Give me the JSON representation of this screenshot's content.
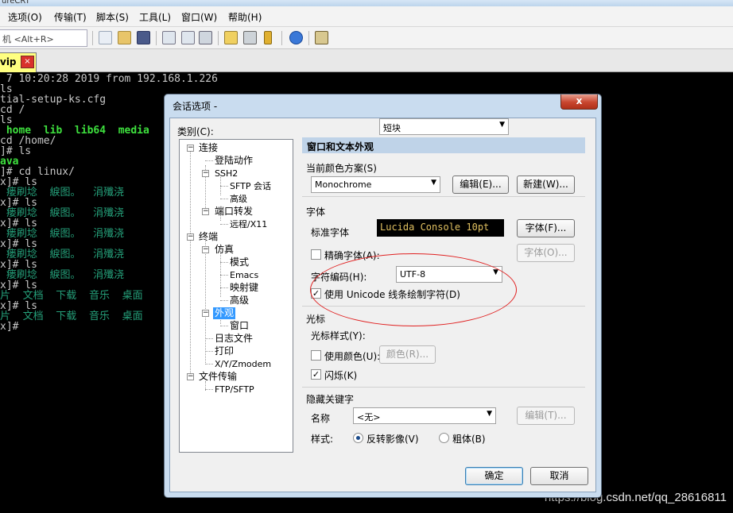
{
  "app": {
    "menu": [
      "选项(O)",
      "传输(T)",
      "脚本(S)",
      "工具(L)",
      "窗口(W)",
      "帮助(H)"
    ],
    "quick_connect_placeholder": "机 <Alt+R>",
    "tab": {
      "label": "vip",
      "close": "×"
    }
  },
  "terminal": {
    "lines": [
      {
        "text": " 7 10:20:28 2019 from 192.168.1.226",
        "cls": "c-gray"
      },
      {
        "text": "ls",
        "cls": "c-gray"
      },
      {
        "text": "tial-setup-ks.cfg",
        "cls": "c-gray"
      },
      {
        "text": "cd /",
        "cls": "c-gray"
      },
      {
        "text": "ls",
        "cls": "c-gray"
      },
      {
        "text": " home  lib  lib64  media",
        "cls": "c-green-b"
      },
      {
        "text": "cd /home/",
        "cls": "c-gray"
      },
      {
        "text": "]# ls",
        "cls": "c-gray"
      },
      {
        "text": "ava",
        "cls": "c-green-b"
      },
      {
        "text": "]# cd linux/",
        "cls": "c-gray"
      },
      {
        "text": "x]# ls",
        "cls": "c-gray"
      },
      {
        "text": " 瘘刷埝  綟图。  涓殲浇  ",
        "cls": "c-teal"
      },
      {
        "text": "x]# ls",
        "cls": "c-gray"
      },
      {
        "text": " 瘘刷埝  綟图。  涓殲浇  ",
        "cls": "c-teal"
      },
      {
        "text": "x]# ls",
        "cls": "c-gray"
      },
      {
        "text": " 瘘刷埝  綟图。  涓殲浇  ",
        "cls": "c-teal"
      },
      {
        "text": "x]# ls",
        "cls": "c-gray"
      },
      {
        "text": " 瘘刷埝  綟图。  涓殲浇  ",
        "cls": "c-teal"
      },
      {
        "text": "x]# ls",
        "cls": "c-gray"
      },
      {
        "text": " 瘘刷埝  綟图。  涓殲浇  ",
        "cls": "c-teal"
      },
      {
        "text": "x]# ls",
        "cls": "c-gray"
      },
      {
        "text": "片  文档  下载  音乐  桌面",
        "cls": "c-teal"
      },
      {
        "text": "x]# ls",
        "cls": "c-gray"
      },
      {
        "text": "片  文档  下载  音乐  桌面",
        "cls": "c-teal"
      },
      {
        "text": "x]# ",
        "cls": "c-gray"
      }
    ]
  },
  "watermark": "https://blog.csdn.net/qq_28616811",
  "dialog": {
    "title": "会话选项 -",
    "close": "x",
    "category_label": "类别(C):",
    "tree": [
      {
        "label": "连接",
        "expander": "−"
      },
      {
        "label": "登陆动作"
      },
      {
        "label": "SSH2",
        "expander": "−"
      },
      {
        "label": "SFTP 会话"
      },
      {
        "label": "高级"
      },
      {
        "label": "端口转发",
        "expander": "−"
      },
      {
        "label": "远程/X11"
      },
      {
        "label": "终端",
        "expander": "−"
      },
      {
        "label": "仿真",
        "expander": "−"
      },
      {
        "label": "模式"
      },
      {
        "label": "Emacs"
      },
      {
        "label": "映射键"
      },
      {
        "label": "高级"
      },
      {
        "label": "外观",
        "expander": "−"
      },
      {
        "label": "窗口"
      },
      {
        "label": "日志文件"
      },
      {
        "label": "打印"
      },
      {
        "label": "X/Y/Zmodem"
      },
      {
        "label": "文件传输",
        "expander": "−"
      },
      {
        "label": "FTP/SFTP"
      }
    ],
    "section_title": "窗口和文本外观",
    "color_scheme": {
      "group": "当前颜色方案(S)",
      "value": "Monochrome",
      "edit": "编辑(E)...",
      "new": "新建(W)..."
    },
    "font": {
      "group": "字体",
      "normal_label": "标准字体",
      "preview": "Lucida Console 10pt",
      "font_btn": "字体(F)...",
      "precise_label": "精确字体(A):",
      "precise_checked": false,
      "precise_btn": "字体(O)...",
      "encoding_label": "字符编码(H):",
      "encoding_value": "UTF-8",
      "unicode_label": "使用 Unicode 线条绘制字符(D)",
      "unicode_checked": true
    },
    "cursor": {
      "group": "光标",
      "style_label": "光标样式(Y):",
      "style_value": "短块",
      "color_label": "使用颜色(U):",
      "color_checked": false,
      "color_btn": "颜色(R)...",
      "blink_label": "闪烁(K)",
      "blink_checked": true
    },
    "hidden_keywords": {
      "group": "隐藏关键字",
      "name_label": "名称",
      "name_value": "<无>",
      "edit_btn": "编辑(T)...",
      "style_label": "样式:",
      "reverse_label": "反转影像(V)",
      "bold_label": "粗体(B)",
      "selected": "reverse"
    },
    "ok": "确定",
    "cancel": "取消"
  }
}
